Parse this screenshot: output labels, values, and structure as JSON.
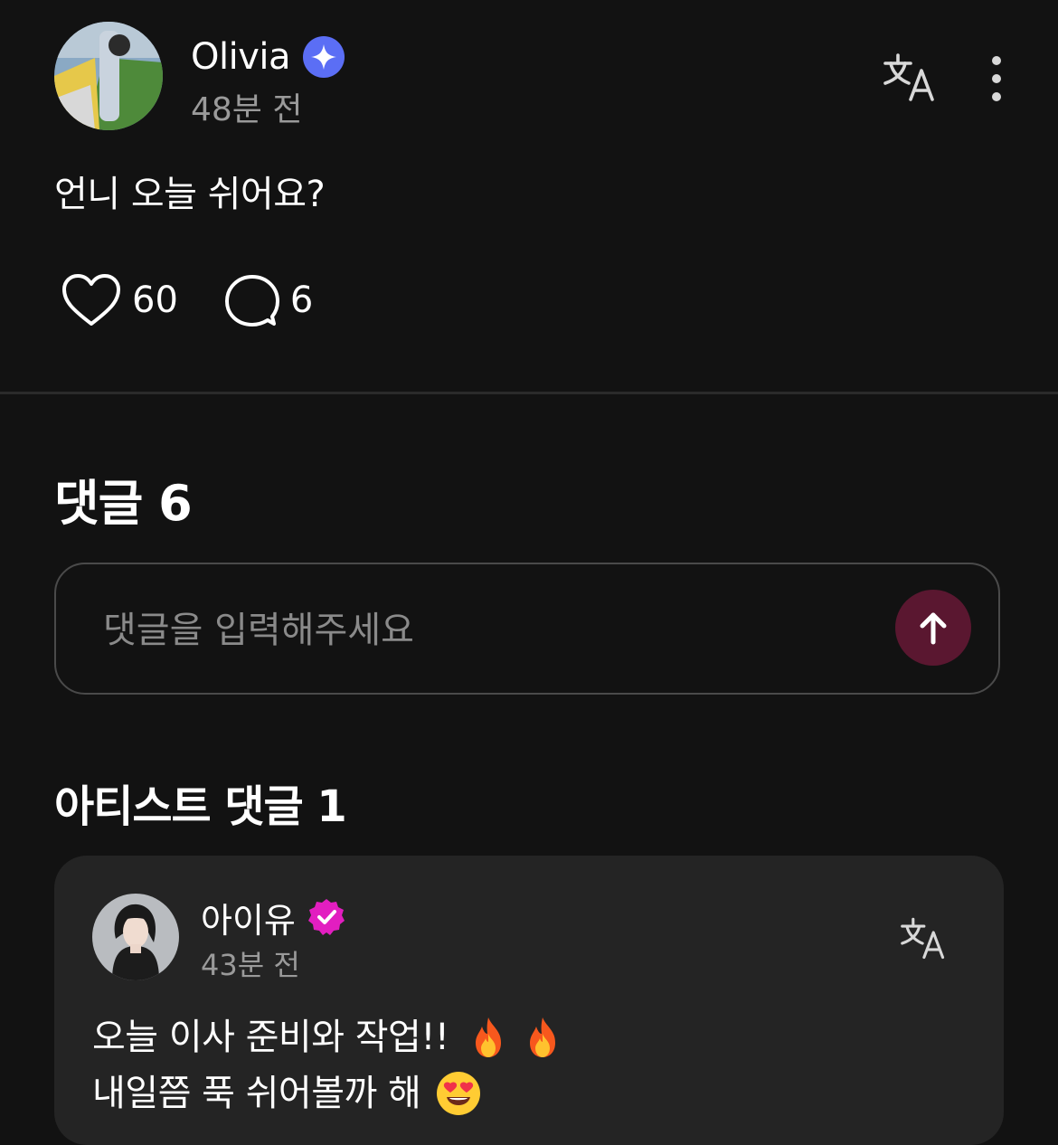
{
  "post": {
    "author_name": "Olivia",
    "time": "48분 전",
    "body": "언니 오늘 쉬어요?",
    "like_count": "60",
    "comment_count": "6",
    "avatar_icon": "profile-photo",
    "verified_icon": "sparkle-badge-icon",
    "verified_color": "#5b6ef5"
  },
  "comments": {
    "title": "댓글 6",
    "input_placeholder": "댓글을 입력해주세요",
    "input_value": "",
    "send_icon": "arrow-up-icon",
    "send_color": "#5a1730"
  },
  "artist_comments": {
    "title": "아티스트 댓글 1",
    "items": [
      {
        "author_name": "아이유",
        "time": "43분 전",
        "line1": "오늘 이사 준비와 작업!!",
        "line2": "내일쯤 푹 쉬어볼까 해",
        "line1_emojis": [
          "fire",
          "fire"
        ],
        "line2_emojis": [
          "heart-eyes"
        ],
        "verified_icon": "check-badge-icon",
        "verified_color": "#e21ec0"
      }
    ]
  }
}
